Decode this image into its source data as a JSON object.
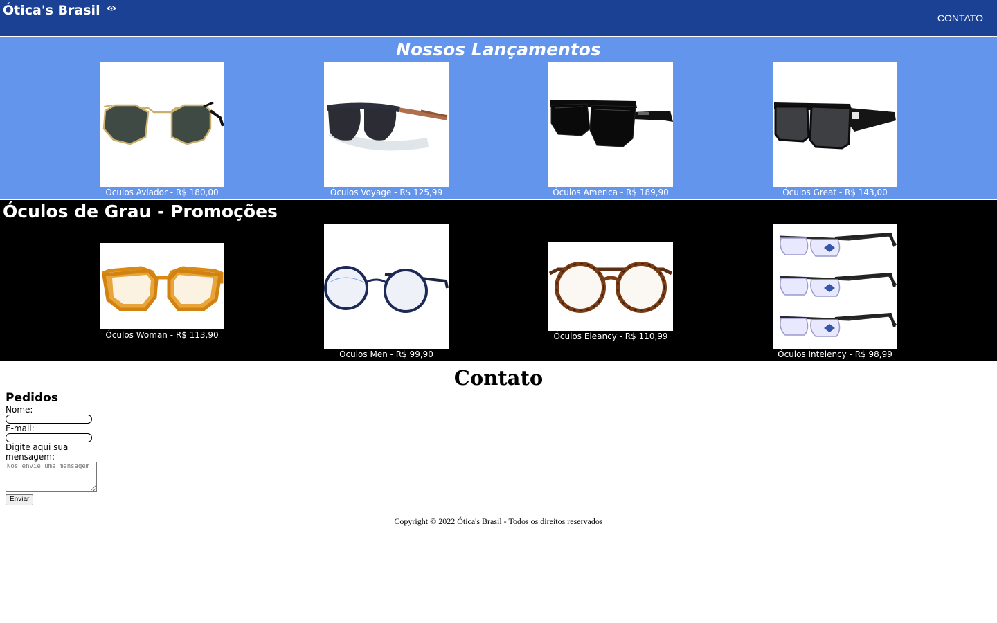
{
  "header": {
    "brand": "Ótica's Brasil",
    "brand_icon": "eye-icon",
    "nav_contact": "CONTATO",
    "color": "#1a4193"
  },
  "launches": {
    "title": "Nossos Lançamentos",
    "color": "#6495ed",
    "items": [
      {
        "caption": "Óculos Aviador - R$ 180,00",
        "image": "aviator-sunglasses-image"
      },
      {
        "caption": "Óculos Voyage - R$ 125,99",
        "image": "voyage-sunglasses-image"
      },
      {
        "caption": "Óculos America - R$ 189,90",
        "image": "america-sunglasses-image"
      },
      {
        "caption": "Óculos Great - R$ 143,00",
        "image": "great-sunglasses-image"
      }
    ]
  },
  "promos": {
    "title": "Óculos de Grau - Promoções",
    "color": "#000000",
    "items": [
      {
        "caption": "Óculos Woman - R$ 113,90",
        "image": "woman-glasses-image"
      },
      {
        "caption": "Óculos Men - R$ 99,90",
        "image": "men-glasses-image"
      },
      {
        "caption": "Óculos Eleancy - R$ 110,99",
        "image": "eleancy-glasses-image"
      },
      {
        "caption": "Óculos Intelency - R$ 98,99",
        "image": "intelency-glasses-image"
      }
    ]
  },
  "contact": {
    "title": "Contato",
    "form_title": "Pedidos",
    "name_label": "Nome:",
    "email_label": "E-mail:",
    "message_label": "Digite aqui sua mensagem:",
    "message_placeholder": "Nos envie uma mensagem",
    "submit_label": "Enviar"
  },
  "footer": {
    "copyright": "Copyright © 2022 Ótica's Brasil - Todos os direitos reservados"
  }
}
